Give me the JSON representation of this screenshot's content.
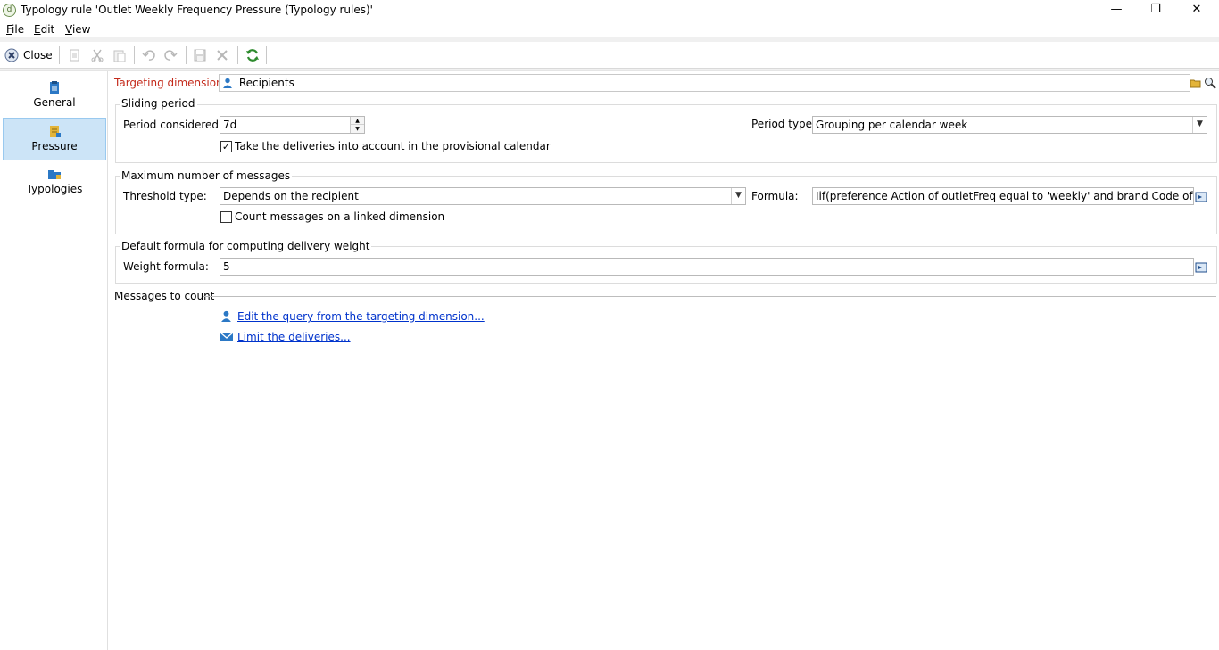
{
  "window": {
    "title": "Typology rule 'Outlet Weekly Frequency Pressure (Typology rules)'",
    "controls": {
      "minimize": "—",
      "restore": "❐",
      "close": "✕"
    }
  },
  "menu": [
    {
      "label": "File",
      "accel": "F",
      "rest": "ile"
    },
    {
      "label": "Edit",
      "accel": "E",
      "rest": "dit"
    },
    {
      "label": "View",
      "accel": "V",
      "rest": "iew"
    }
  ],
  "toolbar": {
    "close_label": "Close"
  },
  "sidebar": [
    {
      "label": "General",
      "icon": "clipboard-icon"
    },
    {
      "label": "Pressure",
      "icon": "notebook-icon"
    },
    {
      "label": "Typologies",
      "icon": "folder-icon"
    }
  ],
  "targeting": {
    "label": "Targeting dimension:",
    "value": "Recipients"
  },
  "sliding": {
    "title": "Sliding period",
    "period_label": "Period considered:",
    "period_value": "7d",
    "type_label": "Period type:",
    "type_value": "Grouping per calendar week",
    "provisional_label": "Take the deliveries into account in the provisional calendar",
    "provisional_checked": true
  },
  "maxmsg": {
    "title": "Maximum number of messages",
    "threshold_label": "Threshold type:",
    "threshold_value": "Depends on the recipient",
    "formula_label": "Formula:",
    "formula_value": "Iif(preference Action of outletFreq equal to 'weekly' and brand Code of outletFreq",
    "linked_label": "Count messages on a linked dimension",
    "linked_checked": false
  },
  "weight": {
    "title": "Default formula for computing delivery weight",
    "label": "Weight formula:",
    "value": "5"
  },
  "messages": {
    "title": "Messages to count",
    "edit_query": "Edit the query from the targeting dimension...",
    "limit": "Limit the deliveries..."
  },
  "colors": {
    "accent": "#cce4f7",
    "link": "#0033cc",
    "required": "#c42b1c"
  }
}
